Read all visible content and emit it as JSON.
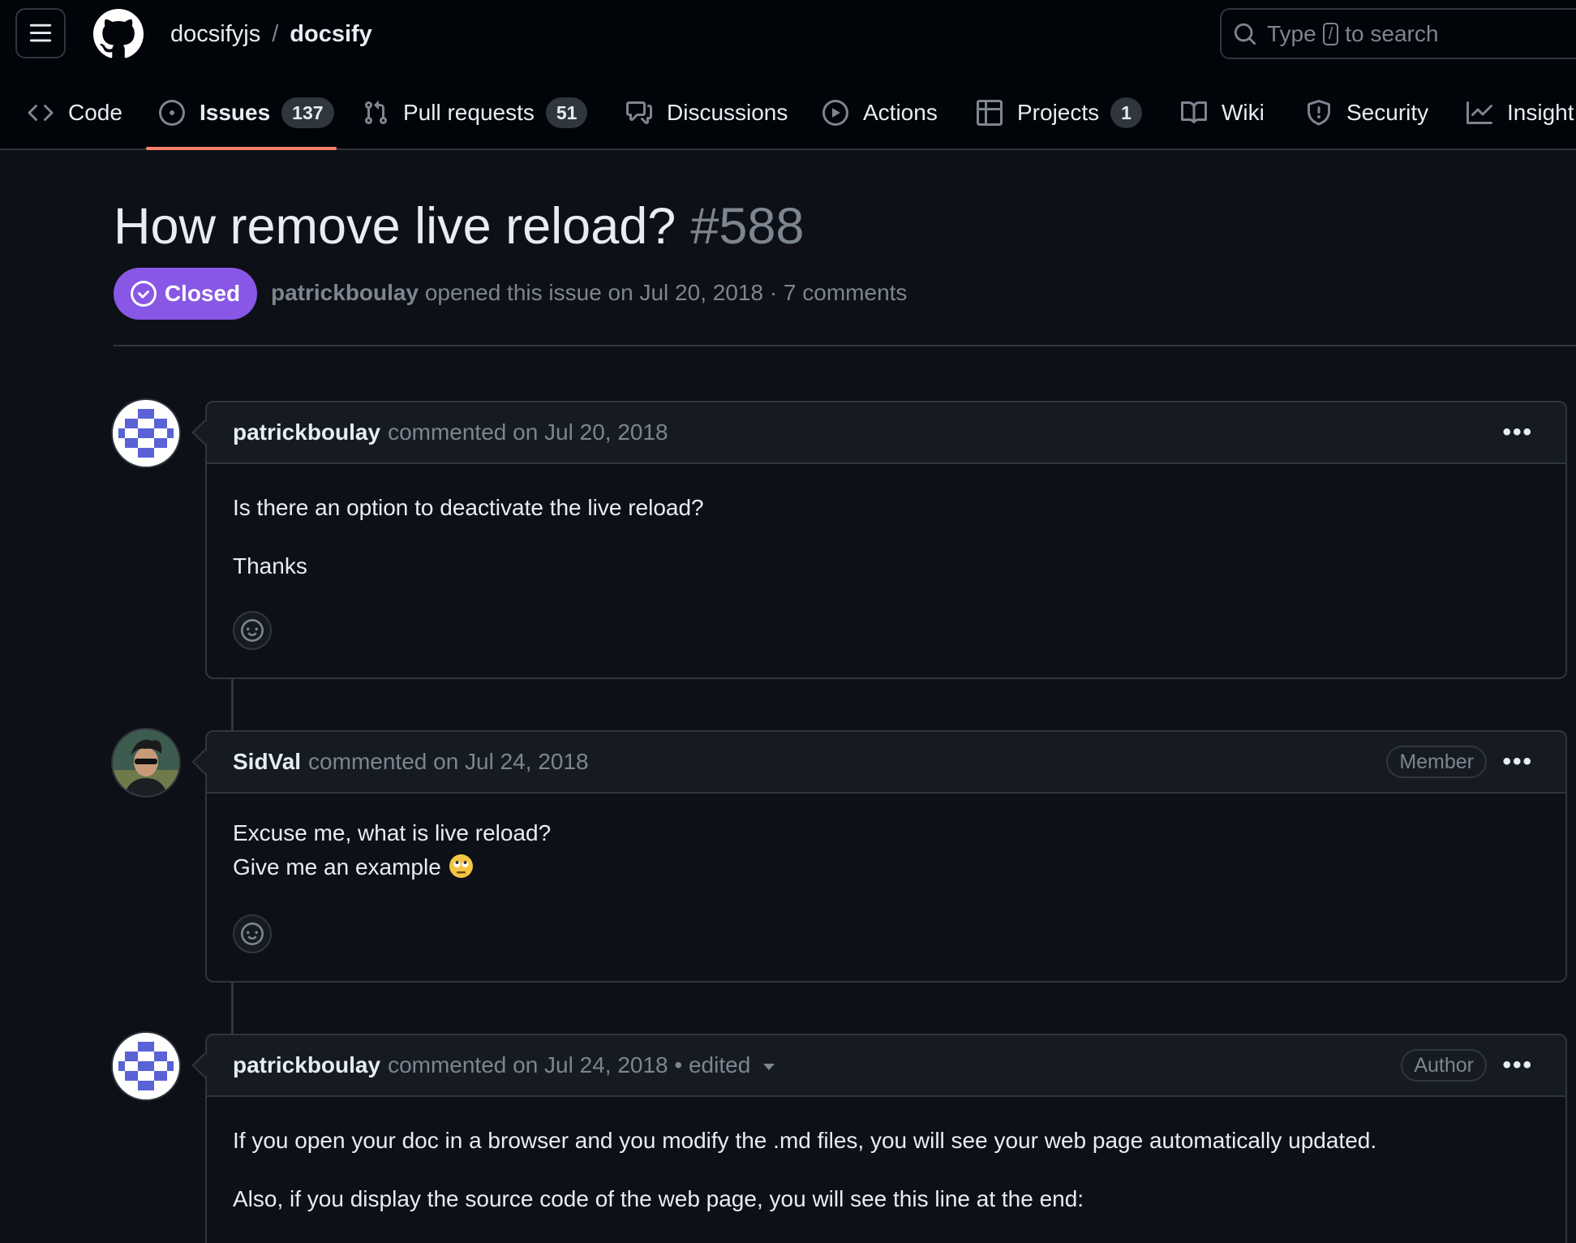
{
  "repo": {
    "owner": "docsifyjs",
    "separator": "/",
    "name": "docsify"
  },
  "search": {
    "prefix": "Type",
    "key": "/",
    "suffix": "to search"
  },
  "tabs": [
    {
      "label": "Code",
      "icon": "code-icon"
    },
    {
      "label": "Issues",
      "icon": "issue-opened-icon",
      "counter": "137",
      "selected": true
    },
    {
      "label": "Pull requests",
      "icon": "git-pull-request-icon",
      "counter": "51"
    },
    {
      "label": "Discussions",
      "icon": "comment-discussion-icon"
    },
    {
      "label": "Actions",
      "icon": "play-icon"
    },
    {
      "label": "Projects",
      "icon": "table-icon",
      "counter": "1"
    },
    {
      "label": "Wiki",
      "icon": "book-icon"
    },
    {
      "label": "Security",
      "icon": "shield-icon"
    },
    {
      "label": "Insight",
      "icon": "graph-icon"
    }
  ],
  "issue": {
    "title": "How remove live reload?",
    "number": "#588",
    "state": "Closed",
    "author": "patrickboulay",
    "meta_text": "opened this issue on Jul 20, 2018 · 7 comments"
  },
  "comments": [
    {
      "user": "patrickboulay",
      "action": "commented on Jul 20, 2018",
      "badge": "",
      "body": [
        "Is there an option to deactivate the live reload?",
        "Thanks"
      ]
    },
    {
      "user": "SidVal",
      "action": "commented on Jul 24, 2018",
      "badge": "Member",
      "body": [
        "Excuse me, what is live reload?",
        "Give me an example"
      ]
    },
    {
      "user": "patrickboulay",
      "action": "commented on Jul 24, 2018 • edited",
      "badge": "Author",
      "body": [
        "If you open your doc in a browser and you modify the .md files, you will see your web page automatically updated.",
        "Also, if you display the source code of the web page, you will see this line at the end:"
      ]
    }
  ],
  "colors": {
    "accent_underline": "#f78166",
    "closed": "#8957e5",
    "bg": "#0d1117",
    "header_bg": "#010409",
    "border": "#30363d",
    "muted": "#7d8590"
  }
}
